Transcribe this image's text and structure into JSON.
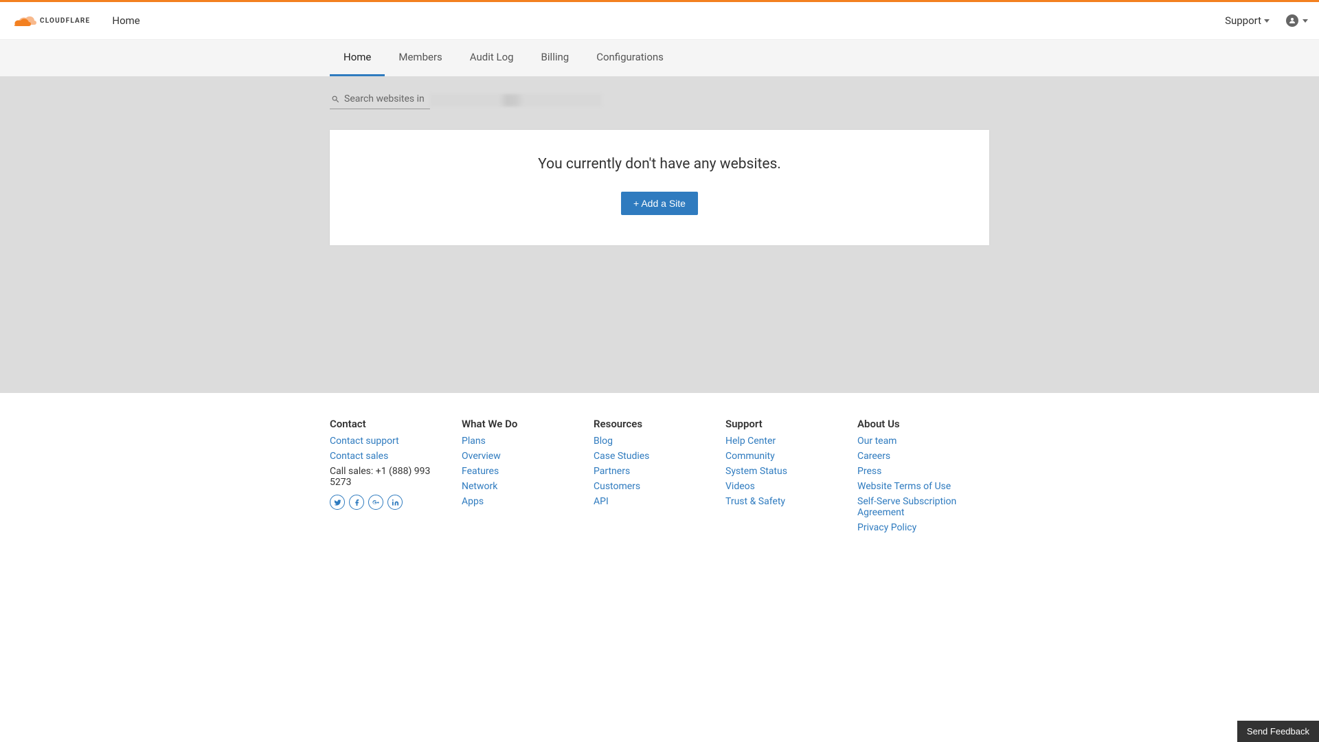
{
  "brand": {
    "name": "CLOUDFLARE",
    "accent_color": "#f38020",
    "link_color": "#2f7bbf"
  },
  "header": {
    "home_label": "Home",
    "support_label": "Support"
  },
  "tabs": [
    {
      "label": "Home",
      "active": true
    },
    {
      "label": "Members",
      "active": false
    },
    {
      "label": "Audit Log",
      "active": false
    },
    {
      "label": "Billing",
      "active": false
    },
    {
      "label": "Configurations",
      "active": false
    }
  ],
  "search": {
    "placeholder_prefix": "Search websites in"
  },
  "empty_state": {
    "message": "You currently don't have any websites.",
    "cta_label": "+ Add a Site"
  },
  "footer": {
    "columns": [
      {
        "heading": "Contact",
        "links": [
          "Contact support",
          "Contact sales"
        ],
        "text": "Call sales: +1 (888) 993 5273",
        "social": true
      },
      {
        "heading": "What We Do",
        "links": [
          "Plans",
          "Overview",
          "Features",
          "Network",
          "Apps"
        ]
      },
      {
        "heading": "Resources",
        "links": [
          "Blog",
          "Case Studies",
          "Partners",
          "Customers",
          "API"
        ]
      },
      {
        "heading": "Support",
        "links": [
          "Help Center",
          "Community",
          "System Status",
          "Videos",
          "Trust & Safety"
        ]
      },
      {
        "heading": "About Us",
        "links": [
          "Our team",
          "Careers",
          "Press",
          "Website Terms of Use",
          "Self-Serve Subscription Agreement",
          "Privacy Policy"
        ]
      }
    ]
  },
  "feedback": {
    "label": "Send Feedback"
  }
}
